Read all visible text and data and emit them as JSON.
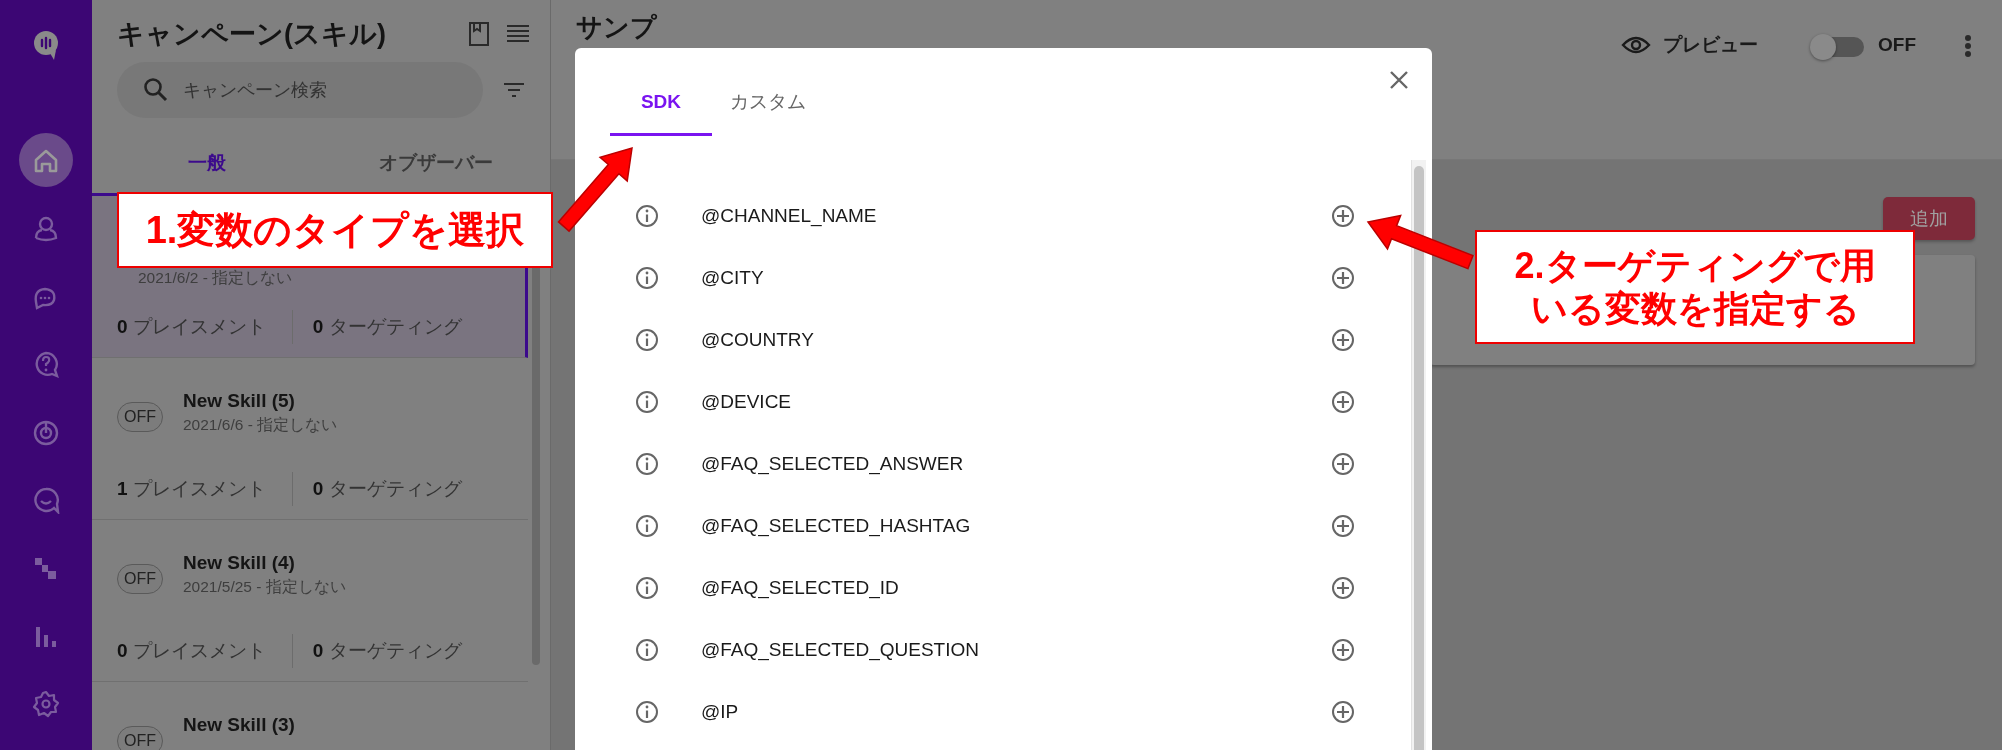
{
  "nav": {
    "items": [
      {
        "selected": true
      },
      {
        "selected": false
      },
      {
        "selected": false
      },
      {
        "selected": false
      },
      {
        "selected": false
      },
      {
        "selected": false
      },
      {
        "selected": false
      },
      {
        "selected": false
      },
      {
        "selected": false
      }
    ]
  },
  "campaigns": {
    "title": "キャンペーン(スキル)",
    "search": {
      "placeholder": "キャンペーン検索"
    },
    "tabs": [
      {
        "label": "一般",
        "selected": true
      },
      {
        "label": "オブザーバー",
        "selected": false
      }
    ],
    "items": [
      {
        "selected": true,
        "date": "2021/6/2 - 指定しない",
        "placements": "**0** プレイスメント",
        "targeting": "**0** ターゲティング"
      },
      {
        "selected": false,
        "status": "OFF",
        "name": "New Skill (5)",
        "date": "2021/6/6 - 指定しない",
        "placements": "**1** プレイスメント",
        "targeting": "**0** ターゲティング"
      },
      {
        "selected": false,
        "status": "OFF",
        "name": "New Skill (4)",
        "date": "2021/5/25 - 指定しない",
        "placements": "**0** プレイスメント",
        "targeting": "**0** ターゲティング"
      },
      {
        "selected": false,
        "status": "OFF",
        "name": "New Skill (3)"
      }
    ]
  },
  "main": {
    "title": "サンプ",
    "preview": "プレビュー",
    "toggle": {
      "on": false,
      "label": "OFF"
    },
    "add_button": "追加"
  },
  "dialog": {
    "tabs": [
      {
        "label": "SDK",
        "selected": true
      },
      {
        "label": "カスタム",
        "selected": false
      }
    ],
    "variables": [
      {
        "name": "@CHANNEL_NAME"
      },
      {
        "name": "@CITY"
      },
      {
        "name": "@COUNTRY"
      },
      {
        "name": "@DEVICE"
      },
      {
        "name": "@FAQ_SELECTED_ANSWER"
      },
      {
        "name": "@FAQ_SELECTED_HASHTAG"
      },
      {
        "name": "@FAQ_SELECTED_ID"
      },
      {
        "name": "@FAQ_SELECTED_QUESTION"
      },
      {
        "name": "@IP"
      }
    ]
  },
  "callouts": [
    {
      "text": "1.変数のタイプを選択"
    },
    {
      "text": "2.ターゲティングで用いる変数を指定する"
    }
  ]
}
